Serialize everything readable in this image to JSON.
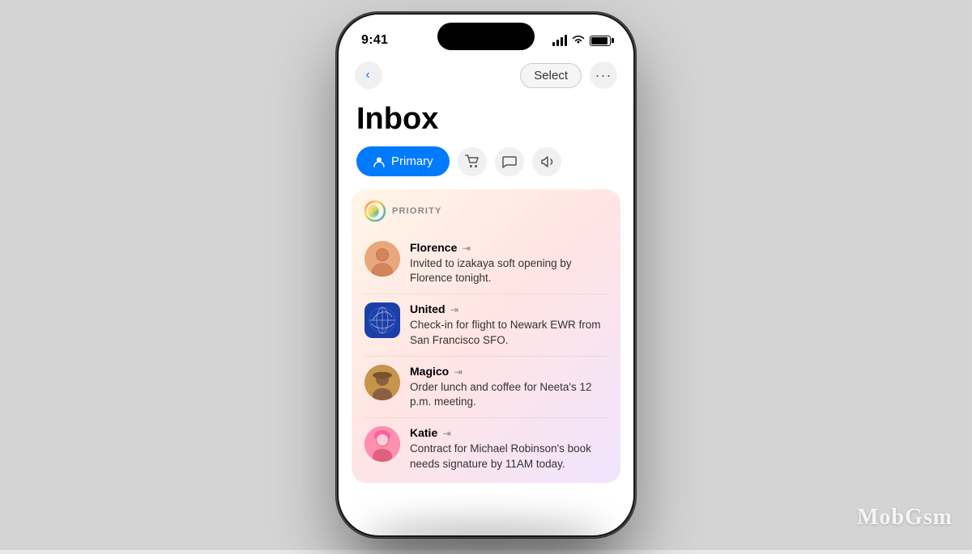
{
  "scene": {
    "background_color": "#d4d4d4"
  },
  "status_bar": {
    "time": "9:41"
  },
  "nav": {
    "back_label": "‹",
    "select_label": "Select",
    "more_label": "···"
  },
  "inbox": {
    "title": "Inbox"
  },
  "tabs": [
    {
      "id": "primary",
      "label": "Primary",
      "active": true,
      "icon": "person"
    },
    {
      "id": "shopping",
      "label": "Shopping",
      "active": false,
      "icon": "cart"
    },
    {
      "id": "social",
      "label": "Social",
      "active": false,
      "icon": "bubble"
    },
    {
      "id": "updates",
      "label": "Updates",
      "active": false,
      "icon": "megaphone"
    }
  ],
  "priority": {
    "label": "PRIORITY",
    "emails": [
      {
        "sender": "Florence",
        "preview": "Invited to izakaya soft opening by Florence tonight.",
        "avatar_type": "florence"
      },
      {
        "sender": "United",
        "preview": "Check-in for flight to Newark EWR from San Francisco SFO.",
        "avatar_type": "united"
      },
      {
        "sender": "Magico",
        "preview": "Order lunch and coffee for Neeta's 12 p.m. meeting.",
        "avatar_type": "magico"
      },
      {
        "sender": "Katie",
        "preview": "Contract for Michael Robinson's book needs signature by 11AM today.",
        "avatar_type": "katie"
      }
    ]
  },
  "watermark": {
    "text": "MobGsm"
  }
}
